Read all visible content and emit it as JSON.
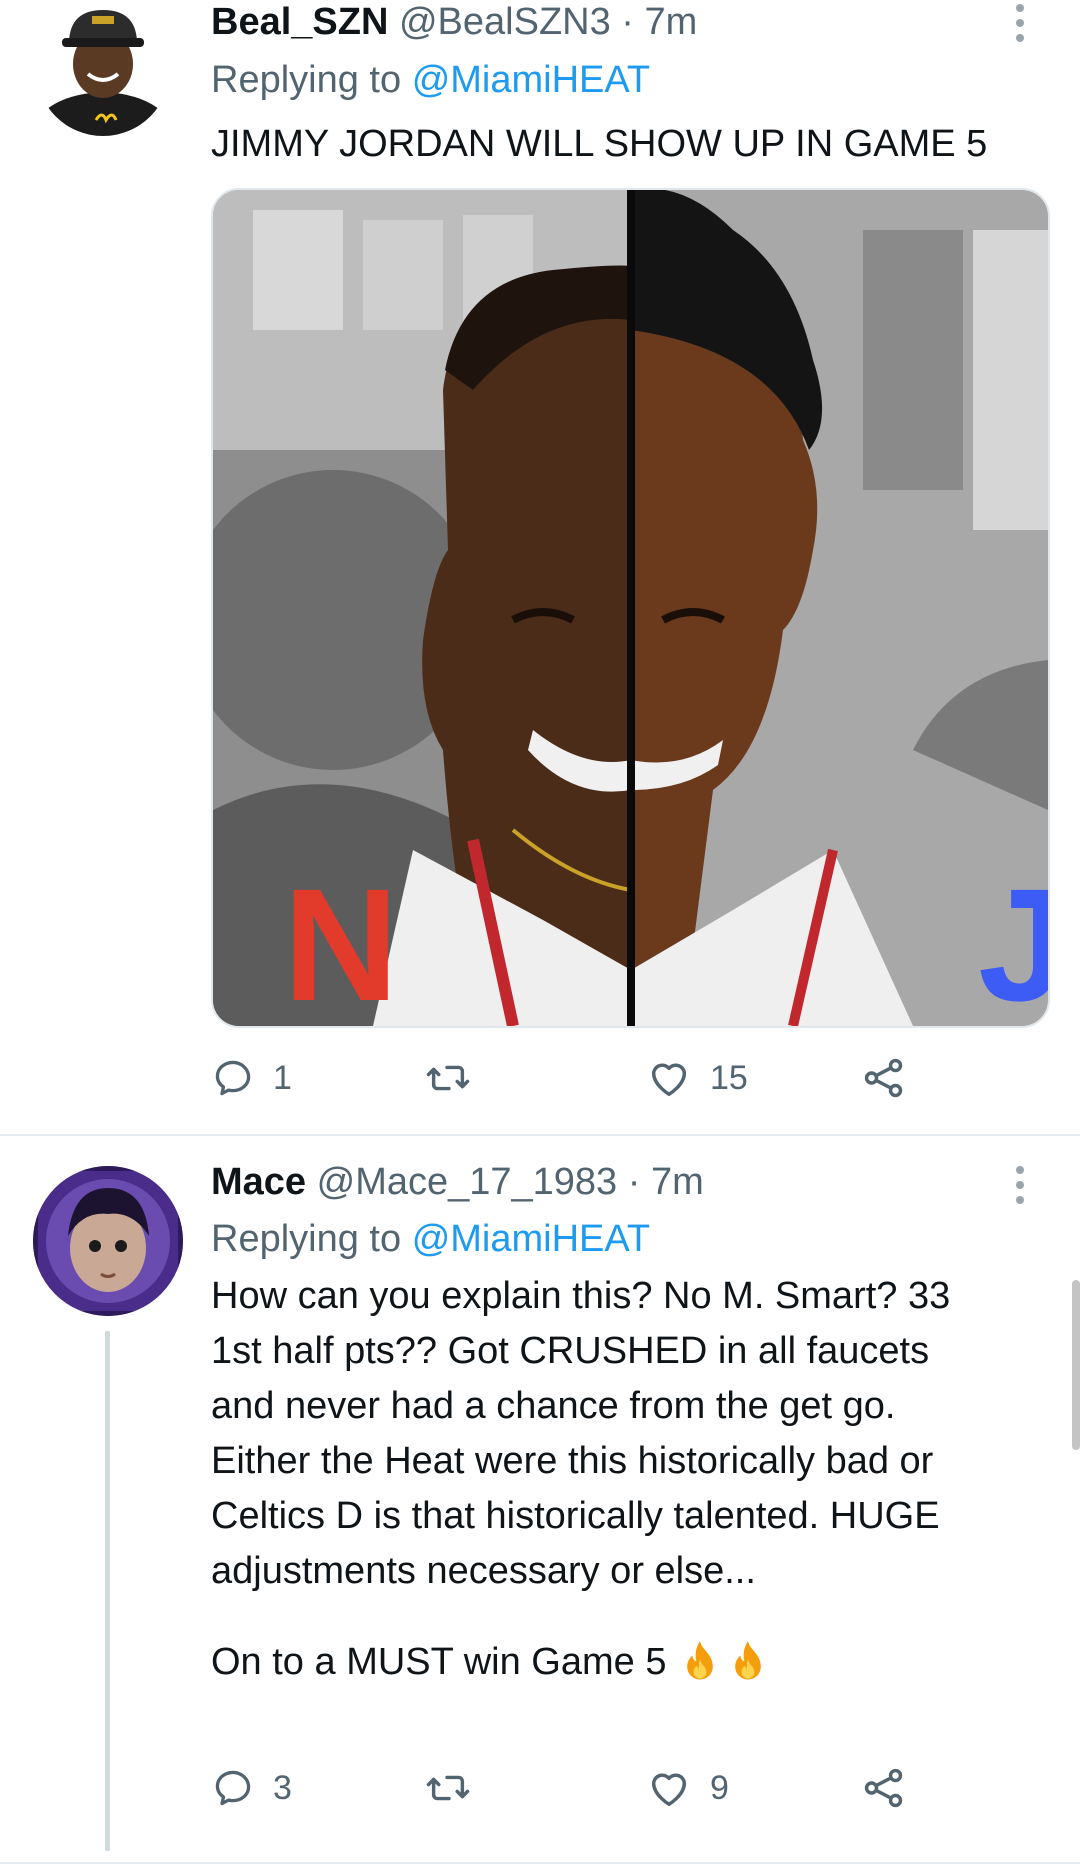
{
  "tweets": [
    {
      "display_name": "Beal_SZN",
      "handle": "@BealSZN3",
      "time": "· 7m",
      "replying_prefix": "Replying to",
      "replying_to": "@MiamiHEAT",
      "text": [
        "JIMMY JORDAN WILL SHOW UP IN GAME 5"
      ],
      "media_letters": {
        "left": "N",
        "right": "JI"
      },
      "replies": "1",
      "retweets": "",
      "likes": "15"
    },
    {
      "display_name": "Mace",
      "handle": "@Mace_17_1983",
      "time": "· 7m",
      "replying_prefix": "Replying to",
      "replying_to": "@MiamiHEAT",
      "text": [
        "How can you explain this? No M. Smart? 33",
        "1st half pts?? Got CRUSHED in all faucets",
        "and never had a chance from the get go.",
        "Either the Heat were this historically bad or",
        "Celtics D is that historically talented. HUGE",
        "adjustments necessary or else...",
        "",
        "On to a MUST win Game 5"
      ],
      "emoji": "🔥🔥",
      "replies": "3",
      "retweets": "",
      "likes": "9"
    }
  ],
  "icons": {
    "reply": "reply-icon",
    "retweet": "retweet-icon",
    "like": "heart-icon",
    "share": "share-icon",
    "more": "more-icon"
  },
  "colors": {
    "link": "#1d9bf0",
    "secondary_text": "#536471",
    "primary_text": "#0f1419",
    "fire": "#f59e0b"
  }
}
